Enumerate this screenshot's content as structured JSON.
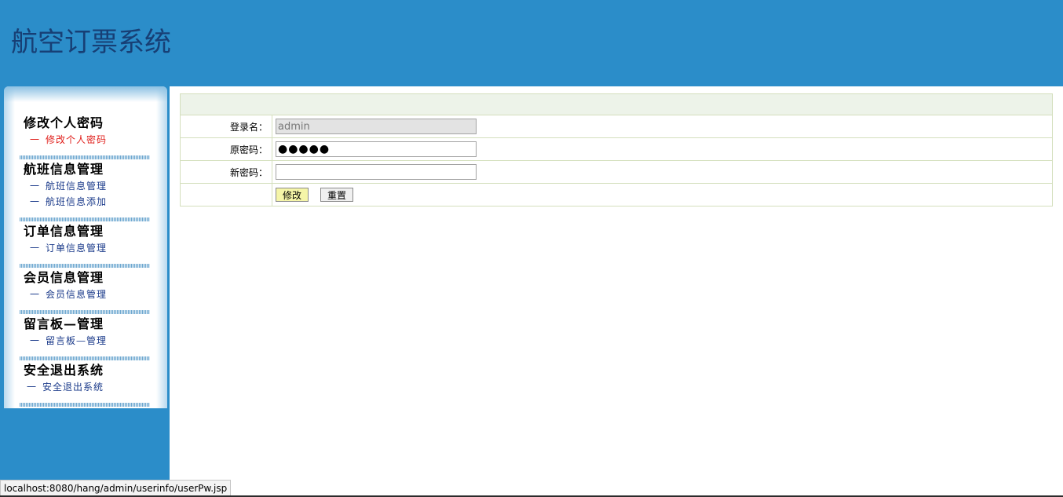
{
  "header": {
    "title": "航空订票系统",
    "bg_color": "#2b8dc9"
  },
  "sidebar": {
    "groups": [
      {
        "title": "修改个人密码",
        "items": [
          "修改个人密码"
        ]
      },
      {
        "title": "航班信息管理",
        "items": [
          "航班信息管理",
          "航班信息添加"
        ]
      },
      {
        "title": "订单信息管理",
        "items": [
          "订单信息管理"
        ]
      },
      {
        "title": "会员信息管理",
        "items": [
          "会员信息管理"
        ]
      },
      {
        "title": "留言板—管理",
        "items": [
          "留言板—管理"
        ]
      },
      {
        "title": "安全退出系统",
        "items": [
          "安全退出系统"
        ]
      }
    ],
    "item_prefix": "一",
    "active_color": "#e0201c",
    "item_color": "#1a3a8a"
  },
  "form": {
    "login_label": "登录名：",
    "login_value": "admin",
    "old_pw_label": "原密码：",
    "old_pw_value": "●●●●●",
    "new_pw_label": "新密码：",
    "new_pw_value": "",
    "submit_label": "修改",
    "reset_label": "重置",
    "border_color": "#d4dfbd",
    "header_bg": "#edf3e9"
  },
  "status_bar": {
    "url": "localhost:8080/hang/admin/userinfo/userPw.jsp"
  }
}
